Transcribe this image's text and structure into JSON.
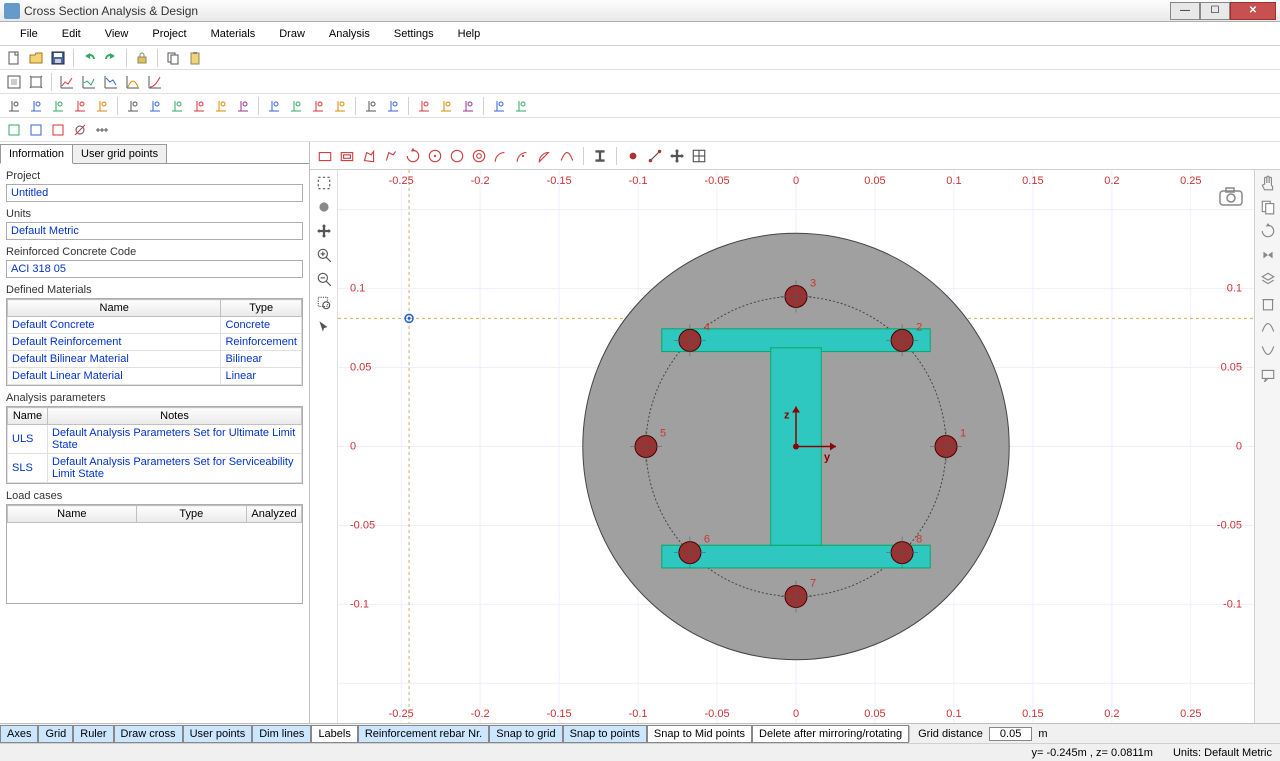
{
  "window": {
    "title": "Cross Section Analysis & Design"
  },
  "menu": [
    "File",
    "Edit",
    "View",
    "Project",
    "Materials",
    "Draw",
    "Analysis",
    "Settings",
    "Help"
  ],
  "left_tabs": {
    "active": "Information",
    "other": "User grid points"
  },
  "project": {
    "label": "Project",
    "value": "Untitled"
  },
  "units": {
    "label": "Units",
    "value": "Default Metric"
  },
  "rc_code": {
    "label": "Reinforced Concrete Code",
    "value": "ACI 318 05"
  },
  "materials": {
    "label": "Defined Materials",
    "headers": [
      "Name",
      "Type"
    ],
    "rows": [
      {
        "name": "Default Concrete",
        "type": "Concrete"
      },
      {
        "name": "Default Reinforcement",
        "type": "Reinforcement"
      },
      {
        "name": "Default Bilinear Material",
        "type": "Bilinear"
      },
      {
        "name": "Default Linear Material",
        "type": "Linear"
      }
    ]
  },
  "analysis_params": {
    "label": "Analysis parameters",
    "headers": [
      "Name",
      "Notes"
    ],
    "rows": [
      {
        "name": "ULS",
        "notes": "Default Analysis Parameters Set for Ultimate Limit State"
      },
      {
        "name": "SLS",
        "notes": "Default Analysis Parameters Set for Serviceability Limit State"
      }
    ]
  },
  "load_cases": {
    "label": "Load cases",
    "headers": [
      "Name",
      "Type",
      "Analyzed"
    ],
    "rows": []
  },
  "status_buttons": [
    {
      "label": "Axes",
      "on": true
    },
    {
      "label": "Grid",
      "on": true
    },
    {
      "label": "Ruler",
      "on": true
    },
    {
      "label": "Draw cross",
      "on": true
    },
    {
      "label": "User points",
      "on": true
    },
    {
      "label": "Dim lines",
      "on": true
    },
    {
      "label": "Labels",
      "on": false
    },
    {
      "label": "Reinforcement rebar Nr.",
      "on": true
    },
    {
      "label": "Snap to grid",
      "on": true
    },
    {
      "label": "Snap to points",
      "on": true
    },
    {
      "label": "Snap to Mid points",
      "on": false
    },
    {
      "label": "Delete after mirroring/rotating",
      "on": false
    }
  ],
  "grid_distance": {
    "label": "Grid distance",
    "value": "0.05",
    "unit": "m"
  },
  "cursor": "y= -0.245m , z= 0.0811m",
  "units_status": "Units: Default Metric",
  "axis": {
    "y": "y",
    "z": "z"
  },
  "ticks": [
    "-0.25",
    "-0.2",
    "-0.15",
    "-0.1",
    "-0.05",
    "0",
    "0.05",
    "0.1",
    "0.15",
    "0.2",
    "0.25"
  ],
  "rebars": [
    {
      "n": "1",
      "a": 0
    },
    {
      "n": "2",
      "a": 45
    },
    {
      "n": "3",
      "a": 90
    },
    {
      "n": "4",
      "a": 135
    },
    {
      "n": "5",
      "a": 180
    },
    {
      "n": "6",
      "a": 225
    },
    {
      "n": "7",
      "a": 270
    },
    {
      "n": "8",
      "a": 315
    }
  ]
}
